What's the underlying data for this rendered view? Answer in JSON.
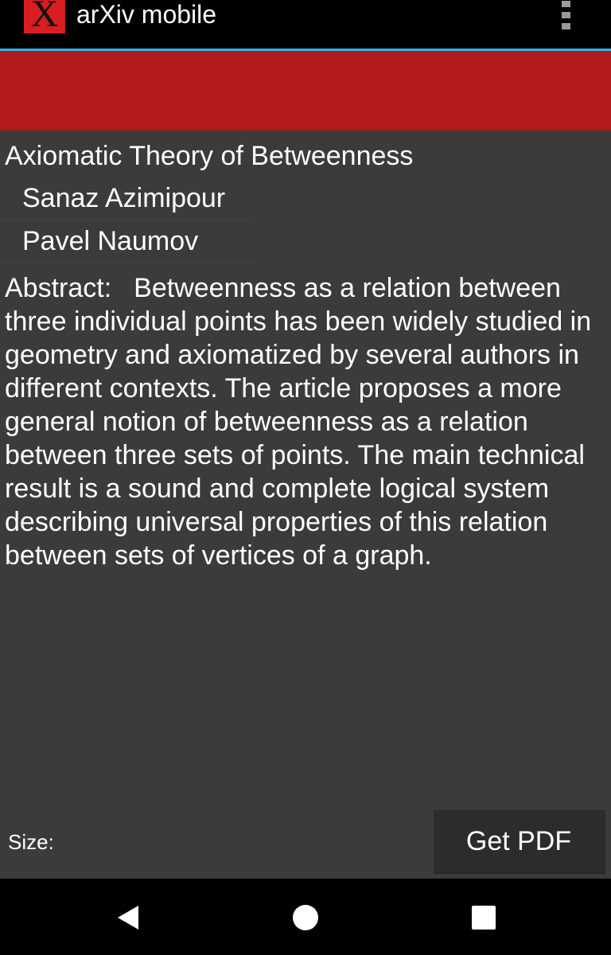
{
  "app": {
    "title": "arXiv mobile",
    "logo_letter": "X",
    "logo_color": "#d81e1e",
    "menu_icon": "overflow-menu-icon"
  },
  "colors": {
    "action_bar": "#000000",
    "divider": "#33b5e5",
    "header_band": "#b21a1b",
    "background": "#3c3b3a",
    "button": "#2b2c2d"
  },
  "paper": {
    "title": "Axiomatic Theory of Betweenness",
    "authors": [
      "Sanaz Azimipour",
      "Pavel Naumov"
    ],
    "abstract_label": "Abstract:",
    "abstract_text": "Betweenness as a relation between three individual points has been widely studied in geometry and axiomatized by several authors in different contexts. The article proposes a more general notion of betweenness as a relation between three sets of points. The main technical result is a sound and complete logical system describing universal properties of this relation between sets of vertices of a graph."
  },
  "footer": {
    "size_label": "Size:",
    "get_pdf_label": "Get PDF"
  },
  "nav": {
    "back_icon": "back-icon",
    "home_icon": "home-icon",
    "recents_icon": "recents-icon"
  }
}
